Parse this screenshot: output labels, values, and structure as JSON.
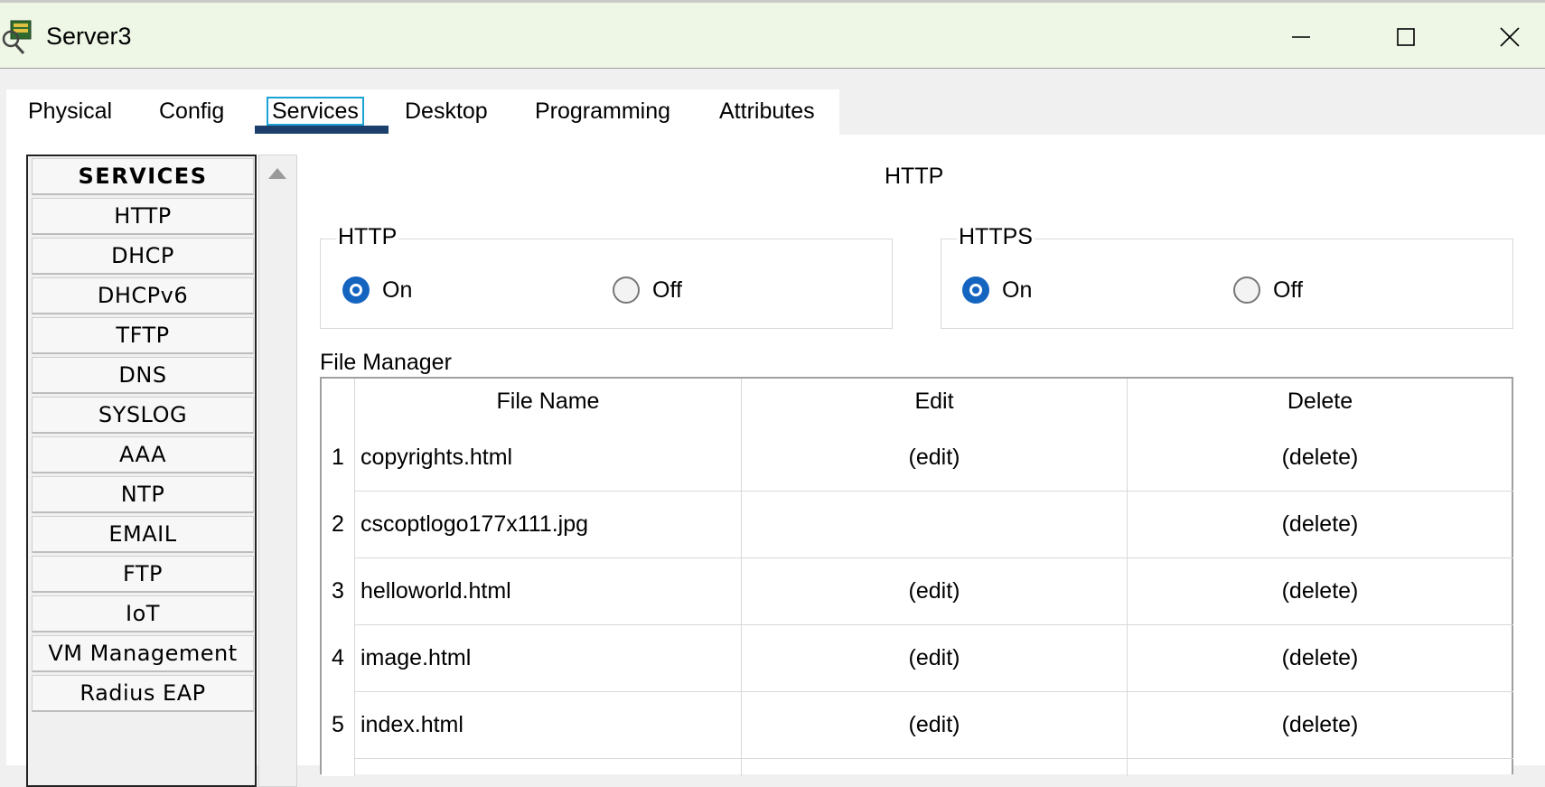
{
  "window": {
    "title": "Server3",
    "icon": "server-icon"
  },
  "tabs": [
    {
      "label": "Physical"
    },
    {
      "label": "Config"
    },
    {
      "label": "Services",
      "active": true
    },
    {
      "label": "Desktop"
    },
    {
      "label": "Programming"
    },
    {
      "label": "Attributes"
    }
  ],
  "sidebar": {
    "header": "SERVICES",
    "items": [
      "HTTP",
      "DHCP",
      "DHCPv6",
      "TFTP",
      "DNS",
      "SYSLOG",
      "AAA",
      "NTP",
      "EMAIL",
      "FTP",
      "IoT",
      "VM Management",
      "Radius EAP"
    ]
  },
  "main": {
    "title": "HTTP",
    "http": {
      "legend": "HTTP",
      "on_label": "On",
      "off_label": "Off",
      "selected": "On"
    },
    "https": {
      "legend": "HTTPS",
      "on_label": "On",
      "off_label": "Off",
      "selected": "On"
    },
    "file_manager": {
      "label": "File Manager",
      "columns": [
        "File Name",
        "Edit",
        "Delete"
      ],
      "rows": [
        {
          "num": "1",
          "name": "copyrights.html",
          "edit": "(edit)",
          "delete": "(delete)"
        },
        {
          "num": "2",
          "name": "cscoptlogo177x111.jpg",
          "edit": "",
          "delete": "(delete)"
        },
        {
          "num": "3",
          "name": "helloworld.html",
          "edit": "(edit)",
          "delete": "(delete)"
        },
        {
          "num": "4",
          "name": "image.html",
          "edit": "(edit)",
          "delete": "(delete)"
        },
        {
          "num": "5",
          "name": "index.html",
          "edit": "(edit)",
          "delete": "(delete)"
        }
      ]
    }
  },
  "colors": {
    "accent": "#1565c0",
    "tab_underline": "#1c3f6b",
    "titlebar_bg": "#eef6e6"
  }
}
